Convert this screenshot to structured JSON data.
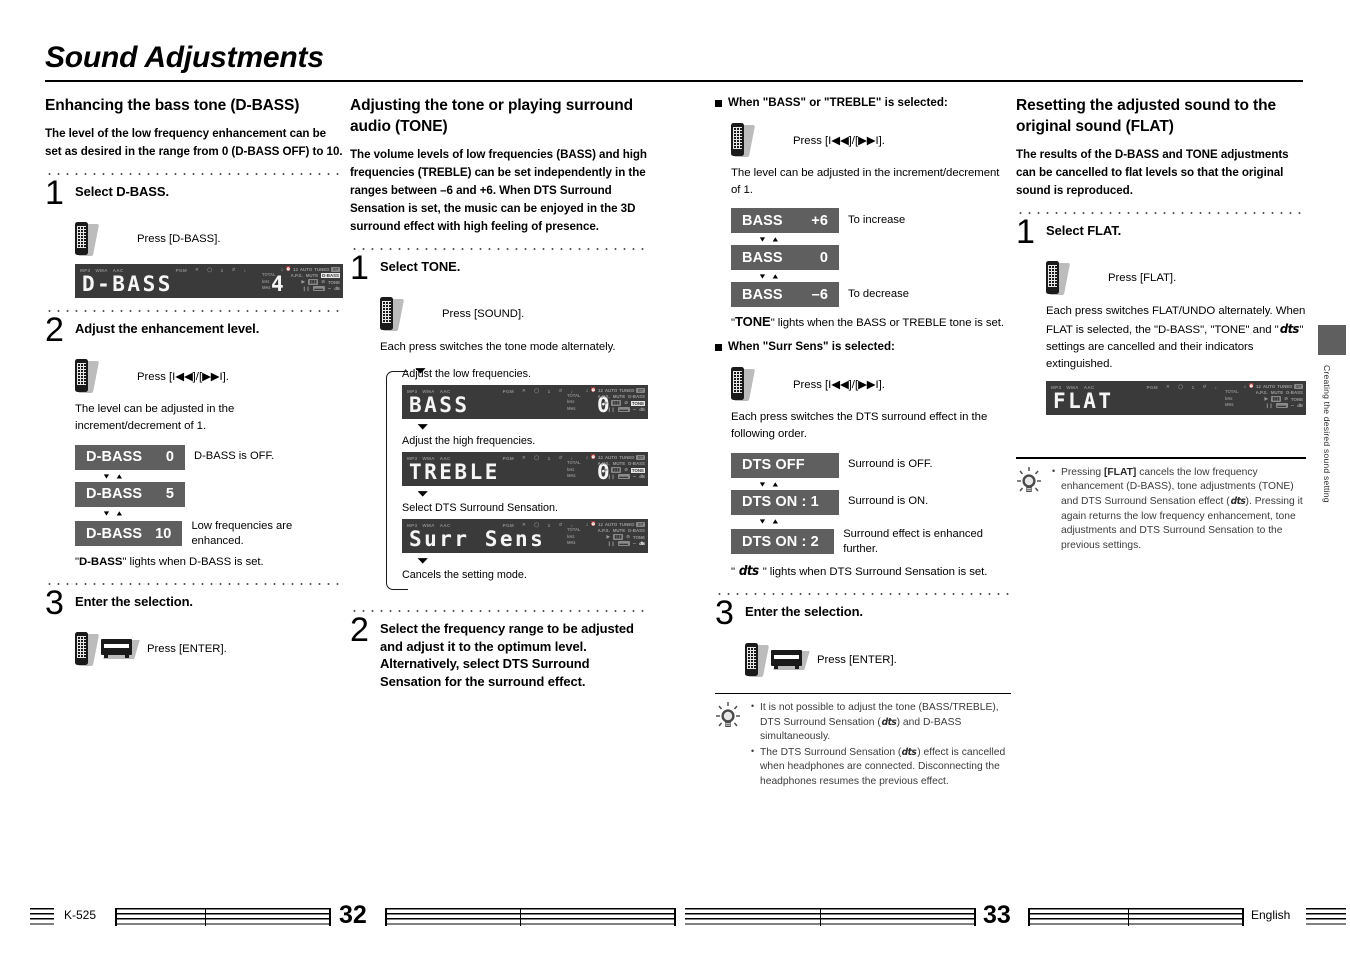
{
  "header": {
    "title": "Sound Adjustments"
  },
  "side_tab": {
    "label": "Creating the desired sound setting"
  },
  "columns": {
    "col1": {
      "heading": "Enhancing the bass tone (D-BASS)",
      "intro": "The level of the low frequency enhancement can be set as desired in the range from 0 (D-BASS OFF) to 10.",
      "step1": {
        "num": "1",
        "title": "Select D-BASS.",
        "press": "Press [D-BASS].",
        "lcd": {
          "text": "D-BASS",
          "value": "4"
        }
      },
      "step2": {
        "num": "2",
        "title": "Adjust the enhancement level.",
        "press": "Press [I◀◀]/[▶▶I].",
        "note": "The level can be adjusted in the increment/decrement of 1.",
        "boxes": [
          {
            "label": "D-BASS",
            "value": "0",
            "note": "D-BASS is OFF."
          },
          {
            "label": "D-BASS",
            "value": "5",
            "note": ""
          },
          {
            "label": "D-BASS",
            "value": "10",
            "note": "Low frequencies are enhanced."
          }
        ],
        "footnote_pre": "\"",
        "footnote_bold": "D-BASS",
        "footnote_post": "\" lights when D-BASS is set."
      },
      "step3": {
        "num": "3",
        "title": "Enter the selection.",
        "press": "Press [ENTER]."
      }
    },
    "col2": {
      "heading": "Adjusting the tone or playing surround audio (TONE)",
      "intro": "The volume levels of low frequencies (BASS) and high frequencies (TREBLE) can be set independently in the ranges between –6 and +6. When DTS Surround Sensation is set, the music can be enjoyed in the 3D surround effect with high feeling of presence.",
      "step1": {
        "num": "1",
        "title": "Select TONE.",
        "press": "Press [SOUND].",
        "note": "Each press switches the tone mode alternately.",
        "flow": [
          {
            "caption": "Adjust the low frequencies.",
            "lcd": {
              "text": "BASS",
              "value": "0",
              "indicator": "TONE"
            }
          },
          {
            "caption": "Adjust the high frequencies.",
            "lcd": {
              "text": "TREBLE",
              "value": "0",
              "indicator": "TONE"
            }
          },
          {
            "caption": "Select DTS Surround Sensation.",
            "lcd": {
              "text": "Surr Sens",
              "value": "",
              "indicator": "dts"
            }
          },
          {
            "caption": "Cancels the setting mode.",
            "lcd": null
          }
        ]
      },
      "step2": {
        "num": "2",
        "title": "Select the frequency range to be adjusted and adjust it to the optimum level. Alternatively, select DTS Surround Sensation for the surround effect."
      }
    },
    "col3": {
      "section_bass": {
        "heading": "When \"BASS\" or \"TREBLE\" is selected:",
        "press": "Press [I◀◀]/[▶▶I].",
        "note": "The level can be adjusted in the increment/decrement of 1.",
        "boxes": [
          {
            "label": "BASS",
            "value": "+6",
            "note": "To increase"
          },
          {
            "label": "BASS",
            "value": "0",
            "note": ""
          },
          {
            "label": "BASS",
            "value": "–6",
            "note": "To decrease"
          }
        ],
        "footnote_pre": "\"",
        "footnote_bold": "TONE",
        "footnote_post": "\" lights when the BASS or TREBLE tone is set."
      },
      "section_surr": {
        "heading": "When \"Surr Sens\" is selected:",
        "press": "Press [I◀◀]/[▶▶I].",
        "note": "Each press switches the DTS surround effect in the following order.",
        "boxes": [
          {
            "label": "DTS OFF",
            "value": "",
            "note": "Surround is OFF."
          },
          {
            "label": "DTS ON : 1",
            "value": "",
            "note": "Surround is ON."
          },
          {
            "label": "DTS ON : 2",
            "value": "",
            "note": "Surround effect is enhanced further."
          }
        ],
        "footnote_pre": "\" ",
        "footnote_bold": "dts",
        "footnote_post": " \" lights when DTS Surround Sensation is set."
      },
      "step3": {
        "num": "3",
        "title": "Enter the selection.",
        "press": "Press [ENTER]."
      },
      "tips": [
        {
          "a": "It is not possible to adjust the tone (BASS/TREBLE), DTS Surround Sensation (",
          "dts": "dts",
          "b": ") and D-BASS simultaneously."
        },
        {
          "a": "The DTS Surround Sensation (",
          "dts": "dts",
          "b": ") effect is cancelled when headphones are connected. Disconnecting the headphones resumes the previous effect."
        }
      ]
    },
    "col4": {
      "heading": "Resetting the adjusted sound to the original sound (FLAT)",
      "intro": "The results of the D-BASS and TONE adjustments can be cancelled to flat levels so that the original sound is reproduced.",
      "step1": {
        "num": "1",
        "title": "Select FLAT.",
        "press": "Press [FLAT].",
        "note_a": "Each press switches FLAT/UNDO alternately. When FLAT is selected, the \"D-BASS\", \"TONE\" and \"",
        "note_dts": "dts",
        "note_b": "\" settings are cancelled and their indicators extinguished.",
        "lcd": {
          "text": "FLAT",
          "value": ""
        }
      },
      "tip": {
        "a": "Pressing ",
        "bold1": "[FLAT]",
        "b": " cancels the low frequency enhancement (D-BASS), tone adjustments (TONE) and DTS Surround Sensation effect (",
        "dts": "dts",
        "c": "). Pressing it again returns the low frequency enhancement, tone adjustments and DTS Surround Sensation to the previous settings."
      }
    }
  },
  "lcd_indicators": {
    "top_left": [
      "MP3",
      "WMA",
      "AAC"
    ],
    "top_mid": [
      "PGM",
      "╳",
      "⬭",
      "1",
      "↻",
      "♪"
    ],
    "right_r1": [
      "♫",
      "⏱",
      "12",
      "AUTO",
      "TUNED",
      "ST"
    ],
    "right_r2": [
      "A.P.S.",
      "MUTE",
      "D-BASS"
    ],
    "right_r3": [
      "▶",
      "▮▮▮",
      "⊘",
      "TONE"
    ],
    "right_r4": [
      "❘❘",
      "▬",
      "∿",
      "dts"
    ],
    "left_units": [
      "TOTAL",
      "kHz",
      "MHz"
    ]
  },
  "footer": {
    "model": "K-525",
    "page_left": "32",
    "page_right": "33",
    "language": "English"
  },
  "colors": {
    "lcd_background": "#3a3a3a",
    "status_box": "#5f5f5f",
    "text": "#000000",
    "tip_text": "#3b3b3b"
  }
}
